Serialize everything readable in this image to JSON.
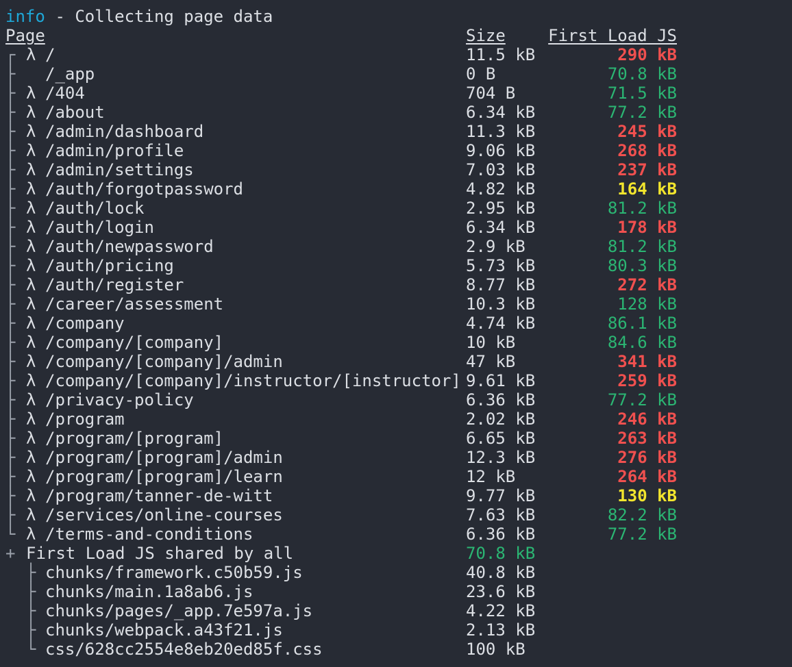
{
  "colors": {
    "background": "#272b34",
    "text": "#dcdfe4",
    "info": "#1ea8d8",
    "green": "#2bb673",
    "yellow": "#f2e52d",
    "red": "#f0504f"
  },
  "status": {
    "tag": "info",
    "message": " - Collecting page data"
  },
  "headers": {
    "page": "Page",
    "size": "Size",
    "first_load": "First Load JS"
  },
  "routes": [
    {
      "tree": "┌",
      "lambda": "λ",
      "route": "/",
      "size": "11.5 kB",
      "first_load": "290 kB",
      "status": "red"
    },
    {
      "tree": "├",
      "lambda": "",
      "route": "/_app",
      "size": "0 B",
      "first_load": "70.8 kB",
      "status": "green"
    },
    {
      "tree": "├",
      "lambda": "λ",
      "route": "/404",
      "size": "704 B",
      "first_load": "71.5 kB",
      "status": "green"
    },
    {
      "tree": "├",
      "lambda": "λ",
      "route": "/about",
      "size": "6.34 kB",
      "first_load": "77.2 kB",
      "status": "green"
    },
    {
      "tree": "├",
      "lambda": "λ",
      "route": "/admin/dashboard",
      "size": "11.3 kB",
      "first_load": "245 kB",
      "status": "red"
    },
    {
      "tree": "├",
      "lambda": "λ",
      "route": "/admin/profile",
      "size": "9.06 kB",
      "first_load": "268 kB",
      "status": "red"
    },
    {
      "tree": "├",
      "lambda": "λ",
      "route": "/admin/settings",
      "size": "7.03 kB",
      "first_load": "237 kB",
      "status": "red"
    },
    {
      "tree": "├",
      "lambda": "λ",
      "route": "/auth/forgotpassword",
      "size": "4.82 kB",
      "first_load": "164 kB",
      "status": "yellow"
    },
    {
      "tree": "├",
      "lambda": "λ",
      "route": "/auth/lock",
      "size": "2.95 kB",
      "first_load": "81.2 kB",
      "status": "green"
    },
    {
      "tree": "├",
      "lambda": "λ",
      "route": "/auth/login",
      "size": "6.34 kB",
      "first_load": "178 kB",
      "status": "red"
    },
    {
      "tree": "├",
      "lambda": "λ",
      "route": "/auth/newpassword",
      "size": "2.9 kB",
      "first_load": "81.2 kB",
      "status": "green"
    },
    {
      "tree": "├",
      "lambda": "λ",
      "route": "/auth/pricing",
      "size": "5.73 kB",
      "first_load": "80.3 kB",
      "status": "green"
    },
    {
      "tree": "├",
      "lambda": "λ",
      "route": "/auth/register",
      "size": "8.77 kB",
      "first_load": "272 kB",
      "status": "red"
    },
    {
      "tree": "├",
      "lambda": "λ",
      "route": "/career/assessment",
      "size": "10.3 kB",
      "first_load": "128 kB",
      "status": "green"
    },
    {
      "tree": "├",
      "lambda": "λ",
      "route": "/company",
      "size": "4.74 kB",
      "first_load": "86.1 kB",
      "status": "green"
    },
    {
      "tree": "├",
      "lambda": "λ",
      "route": "/company/[company]",
      "size": "10 kB",
      "first_load": "84.6 kB",
      "status": "green"
    },
    {
      "tree": "├",
      "lambda": "λ",
      "route": "/company/[company]/admin",
      "size": "47 kB",
      "first_load": "341 kB",
      "status": "red"
    },
    {
      "tree": "├",
      "lambda": "λ",
      "route": "/company/[company]/instructor/[instructor]",
      "size": "9.61 kB",
      "first_load": "259 kB",
      "status": "red"
    },
    {
      "tree": "├",
      "lambda": "λ",
      "route": "/privacy-policy",
      "size": "6.36 kB",
      "first_load": "77.2 kB",
      "status": "green"
    },
    {
      "tree": "├",
      "lambda": "λ",
      "route": "/program",
      "size": "2.02 kB",
      "first_load": "246 kB",
      "status": "red"
    },
    {
      "tree": "├",
      "lambda": "λ",
      "route": "/program/[program]",
      "size": "6.65 kB",
      "first_load": "263 kB",
      "status": "red"
    },
    {
      "tree": "├",
      "lambda": "λ",
      "route": "/program/[program]/admin",
      "size": "12.3 kB",
      "first_load": "276 kB",
      "status": "red"
    },
    {
      "tree": "├",
      "lambda": "λ",
      "route": "/program/[program]/learn",
      "size": "12 kB",
      "first_load": "264 kB",
      "status": "red"
    },
    {
      "tree": "├",
      "lambda": "λ",
      "route": "/program/tanner-de-witt",
      "size": "9.77 kB",
      "first_load": "130 kB",
      "status": "yellow"
    },
    {
      "tree": "├",
      "lambda": "λ",
      "route": "/services/online-courses",
      "size": "7.63 kB",
      "first_load": "82.2 kB",
      "status": "green"
    },
    {
      "tree": "└",
      "lambda": "λ",
      "route": "/terms-and-conditions",
      "size": "6.36 kB",
      "first_load": "77.2 kB",
      "status": "green"
    }
  ],
  "shared": {
    "prefix": "+",
    "label": "First Load JS shared by all",
    "size": "70.8 kB",
    "chunks": [
      {
        "tree": "├",
        "name": "chunks/framework.c50b59.js",
        "size": "40.8 kB"
      },
      {
        "tree": "├",
        "name": "chunks/main.1a8ab6.js",
        "size": "23.6 kB"
      },
      {
        "tree": "├",
        "name": "chunks/pages/_app.7e597a.js",
        "size": "4.22 kB"
      },
      {
        "tree": "├",
        "name": "chunks/webpack.a43f21.js",
        "size": "2.13 kB"
      },
      {
        "tree": "└",
        "name": "css/628cc2554e8eb20ed85f.css",
        "size": "100 kB"
      }
    ]
  }
}
